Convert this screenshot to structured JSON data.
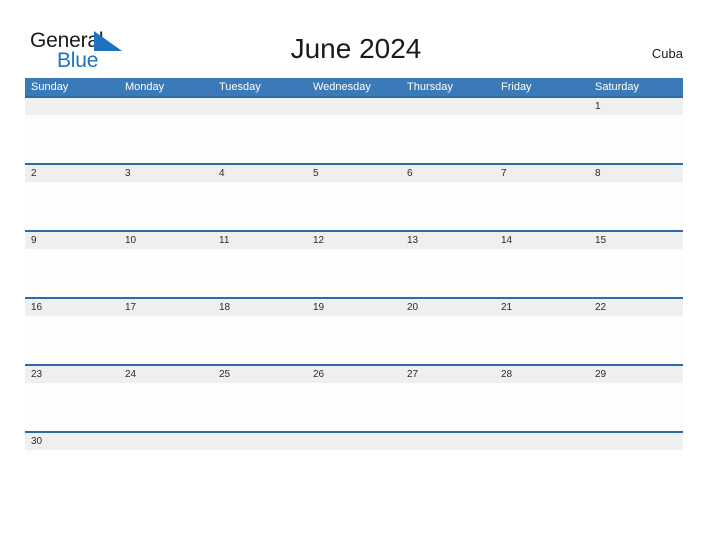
{
  "brand": {
    "name_part1": "General",
    "name_part2": "Blue",
    "flag_icon": "blue-triangle-flag",
    "color_dark": "#1a1a1a",
    "color_blue": "#1d74bd"
  },
  "header": {
    "title": "June 2024",
    "country": "Cuba"
  },
  "calendar": {
    "month": "June",
    "year": "2024",
    "header_bg": "#3a7ab8",
    "row_line_color": "#2d6ca8",
    "date_band_bg": "#efefef",
    "weekdays": [
      "Sunday",
      "Monday",
      "Tuesday",
      "Wednesday",
      "Thursday",
      "Friday",
      "Saturday"
    ],
    "weeks": [
      [
        "",
        "",
        "",
        "",
        "",
        "",
        "1"
      ],
      [
        "2",
        "3",
        "4",
        "5",
        "6",
        "7",
        "8"
      ],
      [
        "9",
        "10",
        "11",
        "12",
        "13",
        "14",
        "15"
      ],
      [
        "16",
        "17",
        "18",
        "19",
        "20",
        "21",
        "22"
      ],
      [
        "23",
        "24",
        "25",
        "26",
        "27",
        "28",
        "29"
      ],
      [
        "30",
        "",
        "",
        "",
        "",
        "",
        ""
      ]
    ]
  }
}
